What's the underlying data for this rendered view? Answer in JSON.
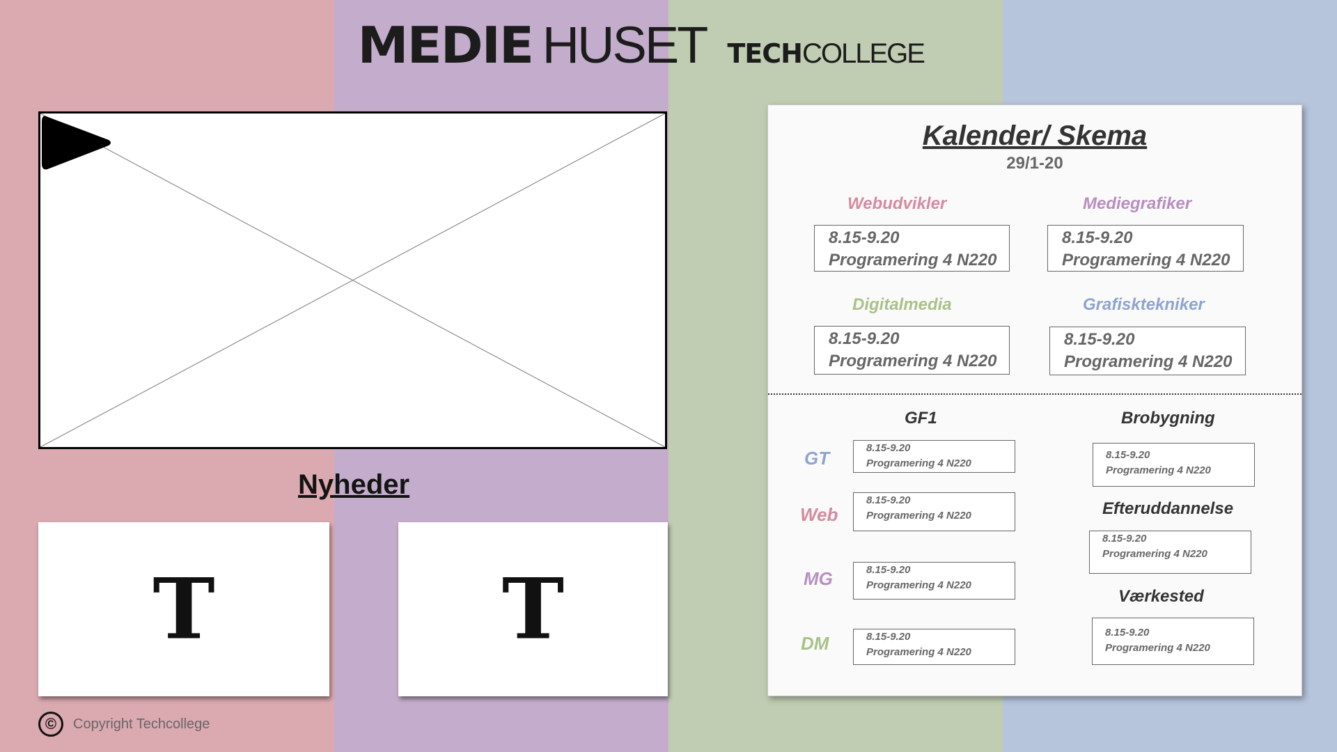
{
  "colors": {
    "stripe_pink": "#dba9b0",
    "stripe_purple": "#c4adcc",
    "stripe_green": "#c0cdb2",
    "stripe_blue": "#b6c4dc",
    "label_pink": "#d48ba0",
    "label_purple": "#b88ec1",
    "label_green": "#a9c189",
    "label_blue": "#8ea4cf"
  },
  "header": {
    "logo_medie": "MEDIE",
    "logo_huset": "HUSET",
    "logo_tech": "TECH",
    "logo_college": "COLLEGE"
  },
  "video": {
    "icon": "play-icon"
  },
  "news": {
    "title": "Nyheder",
    "cards": [
      {
        "placeholder": "T"
      },
      {
        "placeholder": "T"
      }
    ]
  },
  "footer": {
    "copyright_icon": "©",
    "copyright_text": "Copyright Techcollege"
  },
  "calendar": {
    "title": "Kalender/ Skema",
    "date": "29/1-20",
    "programs": [
      {
        "name": "Webudvikler",
        "time": "8.15-9.20",
        "subject": "Programering 4 N220"
      },
      {
        "name": "Mediegrafiker",
        "time": "8.15-9.20",
        "subject": "Programering 4 N220"
      },
      {
        "name": "Digitalmedia",
        "time": "8.15-9.20",
        "subject": "Programering 4 N220"
      },
      {
        "name": "Grafisktekniker",
        "time": "8.15-9.20",
        "subject": "Programering 4 N220"
      }
    ],
    "gf1": {
      "title": "GF1",
      "rows": [
        {
          "label": "GT",
          "time": "8.15-9.20",
          "subject": "Programering 4 N220"
        },
        {
          "label": "Web",
          "time": "8.15-9.20",
          "subject": "Programering 4 N220"
        },
        {
          "label": "MG",
          "time": "8.15-9.20",
          "subject": "Programering 4 N220"
        },
        {
          "label": "DM",
          "time": "8.15-9.20",
          "subject": "Programering 4 N220"
        }
      ]
    },
    "others": [
      {
        "title": "Brobygning",
        "time": "8.15-9.20",
        "subject": "Programering 4 N220"
      },
      {
        "title": "Efteruddannelse",
        "time": "8.15-9.20",
        "subject": "Programering 4 N220"
      },
      {
        "title": "Værkested",
        "time": "8.15-9.20",
        "subject": "Programering 4 N220"
      }
    ]
  }
}
